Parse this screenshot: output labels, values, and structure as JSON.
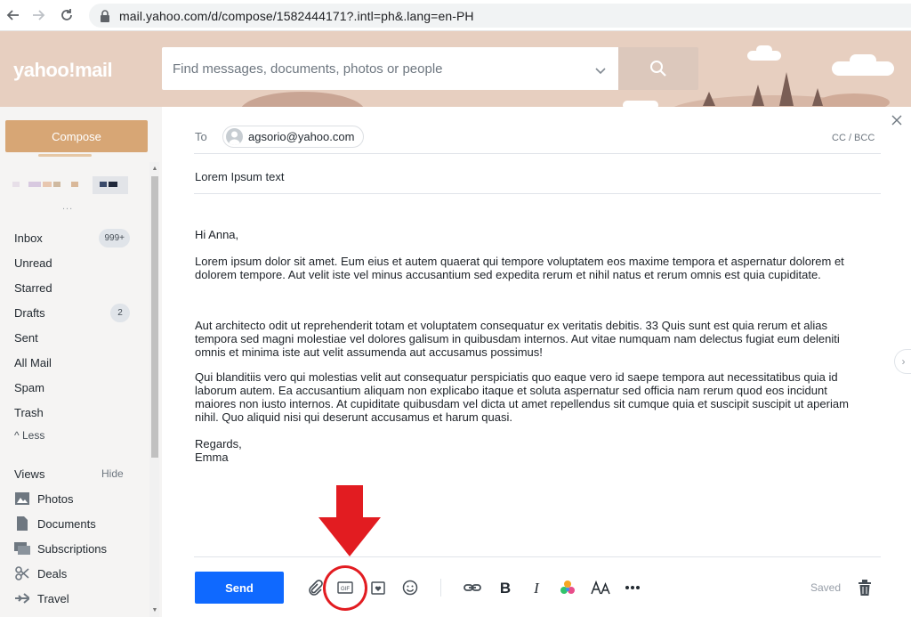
{
  "browser": {
    "url": "mail.yahoo.com/d/compose/1582444171?.intl=ph&.lang=en-PH"
  },
  "header": {
    "logo_text": "yahoo!mail",
    "search_placeholder": "Find messages, documents, photos or people",
    "background_color": "#e7cfc0"
  },
  "sidebar": {
    "compose_label": "Compose",
    "more_dots": "...",
    "folders": [
      {
        "label": "Inbox",
        "badge": "999+"
      },
      {
        "label": "Unread",
        "badge": ""
      },
      {
        "label": "Starred",
        "badge": ""
      },
      {
        "label": "Drafts",
        "badge": "2"
      },
      {
        "label": "Sent",
        "badge": ""
      },
      {
        "label": "All Mail",
        "badge": ""
      },
      {
        "label": "Spam",
        "badge": ""
      },
      {
        "label": "Trash",
        "badge": ""
      }
    ],
    "less_label": "^ Less",
    "views_label": "Views",
    "views_hide_label": "Hide",
    "views": [
      {
        "label": "Photos",
        "icon": "photos-icon"
      },
      {
        "label": "Documents",
        "icon": "documents-icon"
      },
      {
        "label": "Subscriptions",
        "icon": "subscriptions-icon"
      },
      {
        "label": "Deals",
        "icon": "deals-icon"
      },
      {
        "label": "Travel",
        "icon": "travel-icon"
      }
    ]
  },
  "compose": {
    "to_label": "To",
    "recipient": "agsorio@yahoo.com",
    "cc_bcc_label": "CC / BCC",
    "subject": "Lorem Ipsum text",
    "greeting": "Hi Anna,",
    "paragraphs": [
      "Lorem ipsum dolor sit amet. Eum eius et autem quaerat qui tempore voluptatem eos maxime tempora et aspernatur dolorem et dolorem tempore. Aut velit iste vel minus accusantium sed expedita rerum et nihil natus et rerum omnis est quia cupiditate.",
      "Aut architecto odit ut reprehenderit totam et voluptatem consequatur ex veritatis debitis. 33 Quis sunt est quia rerum et alias tempora sed magni molestiae vel dolores galisum in quibusdam internos. Aut vitae numquam nam delectus fugiat eum deleniti omnis et minima iste aut velit assumenda aut accusamus possimus!",
      "Qui blanditiis vero qui molestias velit aut consequatur perspiciatis quo eaque vero id saepe tempora aut necessitatibus quia id laborum autem. Ea accusantium aliquam non explicabo itaque et soluta aspernatur sed officia nam rerum quod eos incidunt maiores non iusto internos. At cupiditate quibusdam vel dicta ut amet repellendus sit cumque quia et suscipit suscipit ut aperiam nihil. Quo aliquid nisi qui deserunt accusamus et harum quasi."
    ],
    "closing": "Regards,",
    "signature": "Emma"
  },
  "toolbar": {
    "send_label": "Send",
    "gif_label": "GIF",
    "saved_label": "Saved",
    "send_color": "#0f69ff",
    "icons": [
      "attach-icon",
      "gif-icon",
      "sticker-icon",
      "emoji-icon",
      "link-icon",
      "bold-icon",
      "italic-icon",
      "color-icon",
      "font-size-icon",
      "more-icon",
      "trash-icon"
    ]
  },
  "annotation": {
    "color": "#e21c21"
  }
}
